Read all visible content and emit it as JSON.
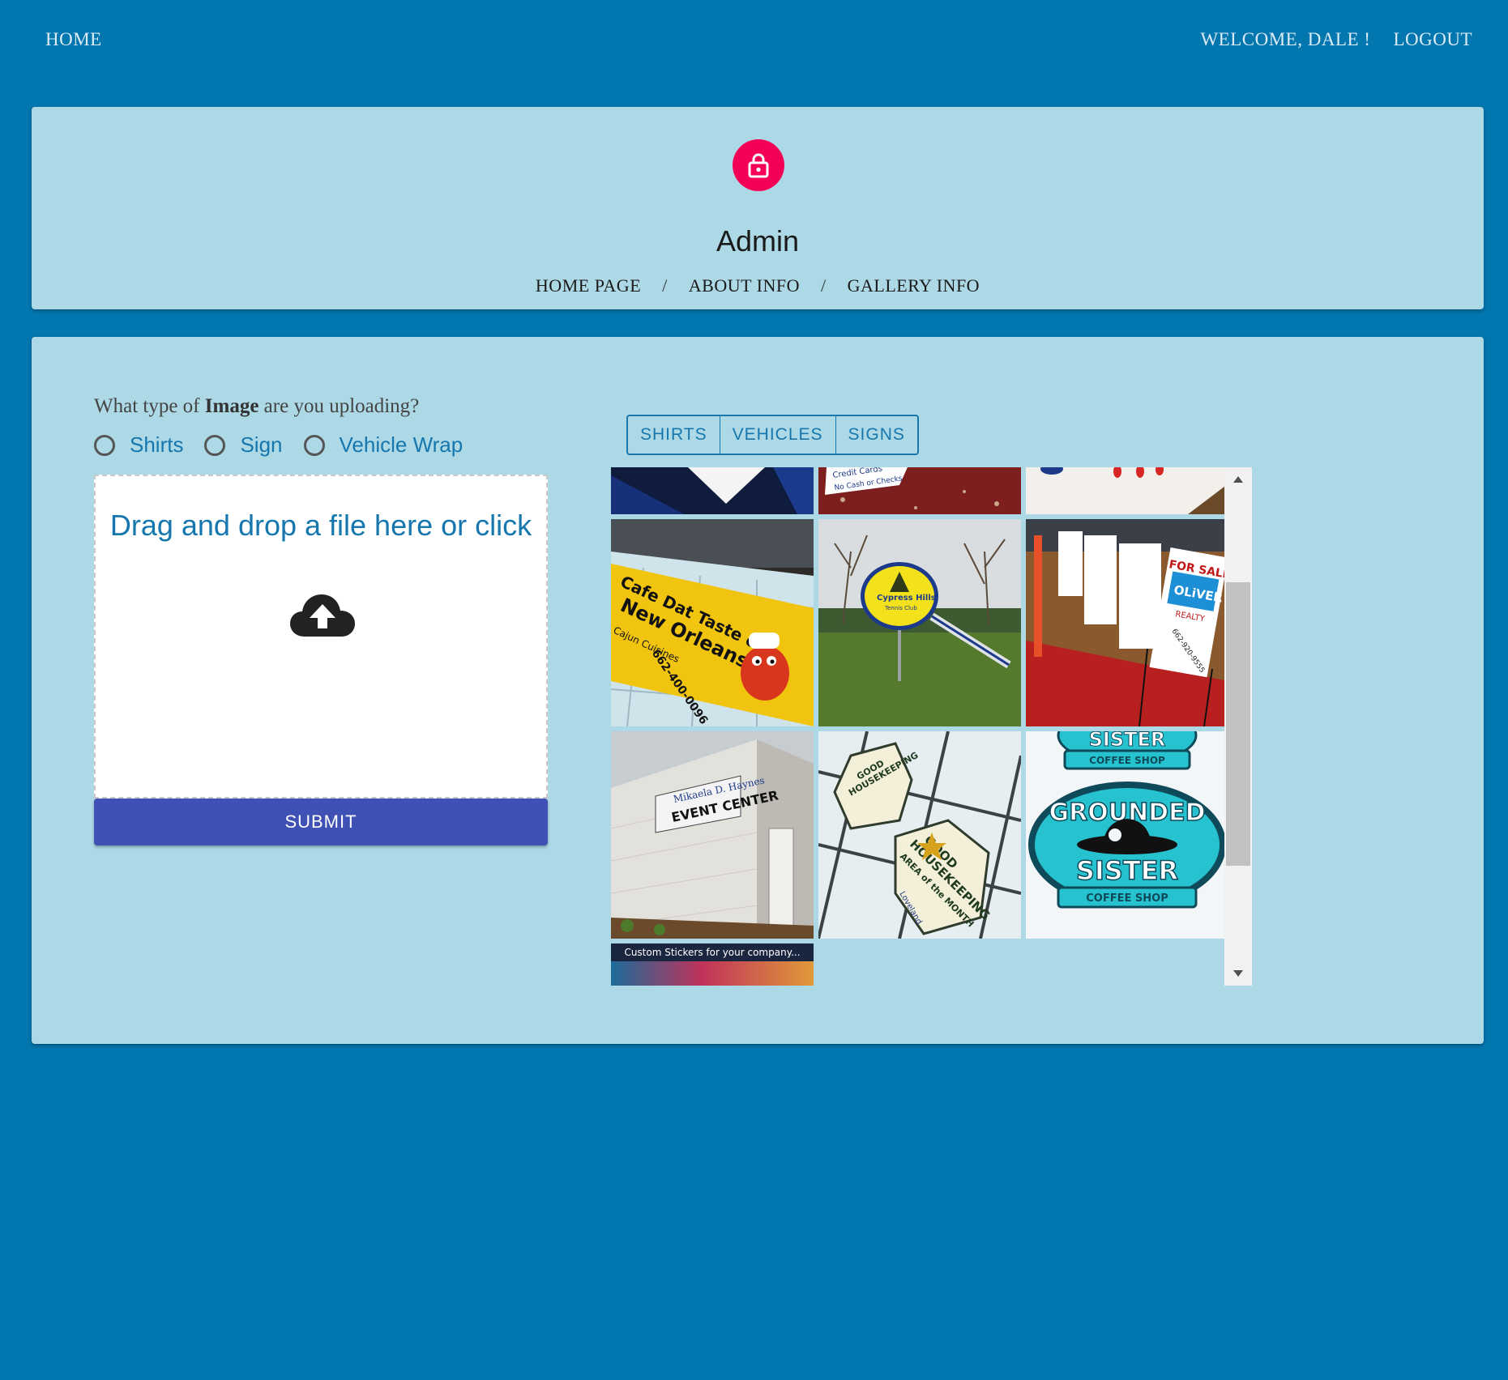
{
  "nav": {
    "home": "HOME",
    "welcome": "WELCOME, DALE !",
    "logout": "LOGOUT"
  },
  "header": {
    "avatar_icon": "lock-icon",
    "avatar_color": "#f50057",
    "title": "Admin",
    "links": [
      "HOME PAGE",
      "ABOUT INFO",
      "GALLERY INFO"
    ],
    "separator": "/"
  },
  "upload": {
    "question_prefix": "What type of",
    "question_bold": "Image",
    "question_suffix": "are you uploading?",
    "options": [
      "Shirts",
      "Sign",
      "Vehicle Wrap"
    ],
    "dropzone_text": "Drag and drop a file here or click",
    "dropzone_icon": "cloud-upload-icon",
    "submit_label": "SUBMIT"
  },
  "gallery": {
    "filters": [
      "SHIRTS",
      "VEHICLES",
      "SIGNS"
    ],
    "thumbnails": [
      {
        "alt": "blue sign fragment"
      },
      {
        "alt": "Credit Cards No Cash or Checks sign"
      },
      {
        "alt": "white sign with red dots"
      },
      {
        "alt": "Taste of New Orleans banner"
      },
      {
        "alt": "Cypress Hills Tennis Club sign"
      },
      {
        "alt": "For Sale Oliver Realty signs"
      },
      {
        "alt": "Event Center building sign"
      },
      {
        "alt": "Good Housekeeping decals"
      },
      {
        "alt": "Grounded Sister Coffee Shop sticker"
      },
      {
        "alt": "Custom stickers promo"
      }
    ],
    "texts": {
      "credit": "Credit Cards",
      "nocash": "No Cash or Checks",
      "cafe1": "Cafe Dat Taste of",
      "cafe2": "New Orleans",
      "cafe3": "Cajun Cuisines",
      "cafe4": "662-400-0096",
      "tennis1": "Cypress Hills",
      "tennis2": "Tennis Club",
      "forsale": "FOR SALE",
      "oliver": "OLiVER",
      "realty": "REALTY",
      "realty_phone": "662-920-9555",
      "event1": "Mikaela D. Haynes",
      "event2": "EVENT CENTER",
      "gh1": "GOOD",
      "gh2": "HOUSEKEEPING",
      "gh3": "AREA of the MONTH",
      "gh4": "Loveland",
      "sister_top": "SISTER",
      "coffee": "COFFEE SHOP",
      "grounded": "GROUNDED",
      "sister": "SISTER",
      "stickers": "Custom Stickers for your company..."
    },
    "scrollbar": {
      "thumb_position": 0.3
    }
  },
  "colors": {
    "page_bg": "#0276ae",
    "card_bg": "#add8e6",
    "accent_text": "#1577ad",
    "submit_bg": "#3f51b5"
  }
}
